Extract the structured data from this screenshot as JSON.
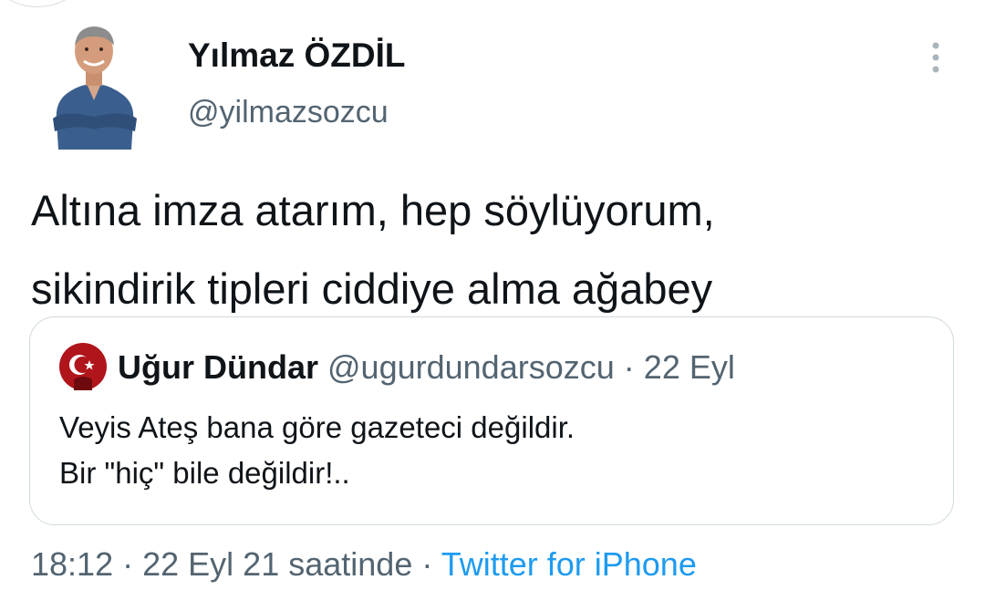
{
  "author": {
    "name": "Yılmaz ÖZDİL",
    "handle": "@yilmazsozcu",
    "avatar_icon": "profile-photo"
  },
  "more_icon": "vertical-ellipsis-icon",
  "tweet": {
    "lines": [
      "Altına imza atarım, hep söylüyorum,",
      "sikindirik tipleri ciddiye alma ağabey"
    ]
  },
  "quoted_tweet": {
    "name": "Uğur Dündar",
    "handle": "@ugurdundarsozcu",
    "separator": "·",
    "date": "22 Eyl",
    "avatar_icon": "turkish-flag-profile",
    "lines": [
      "Veyis Ateş bana göre gazeteci değildir.",
      "Bir \"hiç\" bile değildir!.."
    ]
  },
  "meta": {
    "time": "18:12",
    "separator1": "·",
    "date": "22 Eyl 21 saatinde",
    "separator2": "·",
    "source": "Twitter for iPhone"
  },
  "colors": {
    "text": "#0f1419",
    "secondary": "#536471",
    "link": "#1d9bf0",
    "border": "#cfd9de"
  }
}
